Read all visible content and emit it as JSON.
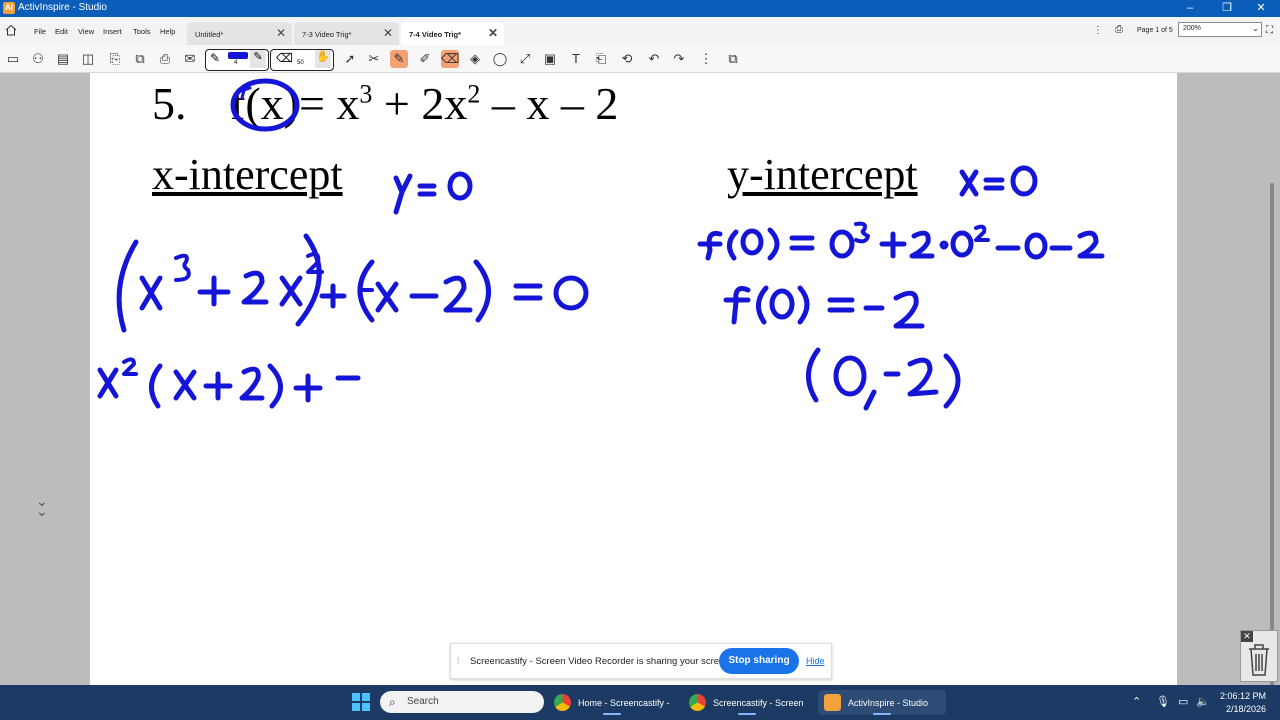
{
  "titlebar": {
    "app_icon": "AI",
    "title": "ActivInspire - Studio",
    "minimize": "–",
    "maximize": "❐",
    "close": "✕"
  },
  "menu": {
    "items": [
      "File",
      "Edit",
      "View",
      "Insert",
      "Tools",
      "Help"
    ]
  },
  "tabs": [
    {
      "label": "Untitled*",
      "close": "✕"
    },
    {
      "label": "7-3 Video Trig*",
      "close": "✕"
    },
    {
      "label": "7-4 Video Trig*",
      "close": "✕"
    }
  ],
  "page_indicator": "Page 1 of 5",
  "zoom": "200%",
  "toolbar": {
    "pen_width": "4",
    "eraser_width": "50"
  },
  "problem": {
    "number": "5.",
    "x_heading": "x-intercept",
    "y_heading": "y-intercept"
  },
  "colors": {
    "ink": "#1515d8",
    "highlight_tool": "#f6a173",
    "titlebar": "#0a5db8",
    "taskbar": "#1c3a63",
    "share_button": "#1a73e8"
  },
  "notice": {
    "message": "Screencastify - Screen Video Recorder is sharing your screen.",
    "stop_label": "Stop sharing",
    "hide_label": "Hide"
  },
  "taskbar": {
    "search_placeholder": "Search",
    "apps": [
      {
        "label": "Home - Screencastify - ı",
        "icon": "chrome-icon"
      },
      {
        "label": "Screencastify - Screen V",
        "icon": "chrome-icon"
      },
      {
        "label": "ActivInspire - Studio",
        "icon": "activinspire-icon"
      }
    ],
    "time": "2:06:12 PM",
    "date": "2/18/2026"
  }
}
